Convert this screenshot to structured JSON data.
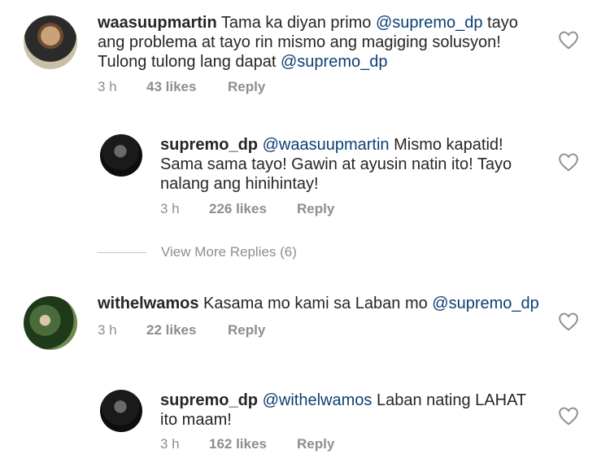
{
  "comments": [
    {
      "username": "waasuupmartin",
      "text_parts": [
        "Tama ka diyan primo ",
        "@supremo_dp",
        " tayo ang problema at tayo rin mismo ang magiging solusyon! Tulong tulong lang dapat ",
        "@supremo_dp"
      ],
      "time": "3 h",
      "likes": "43 likes",
      "reply": "Reply",
      "avatar_icon": "user-avatar-icon"
    },
    {
      "username": "supremo_dp",
      "text_parts": [
        "@waasuupmartin",
        " Mismo kapatid! Sama sama tayo! Gawin at ayusin natin ito! Tayo nalang ang hinihintay!"
      ],
      "time": "3 h",
      "likes": "226 likes",
      "reply": "Reply",
      "avatar_icon": "user-avatar-icon"
    },
    {
      "username": "withelwamos",
      "text_parts": [
        "Kasama mo kami sa Laban mo ",
        "@supremo_dp"
      ],
      "time": "3 h",
      "likes": "22 likes",
      "reply": "Reply",
      "avatar_icon": "user-avatar-icon"
    },
    {
      "username": "supremo_dp",
      "text_parts": [
        "@withelwamos",
        " Laban nating LAHAT ito maam!"
      ],
      "time": "3 h",
      "likes": "162 likes",
      "reply": "Reply",
      "avatar_icon": "user-avatar-icon"
    }
  ],
  "view_more_replies": "View More Replies (6)",
  "colors": {
    "mention": "#0d3f73",
    "meta": "#8e8e8e",
    "text": "#262626"
  }
}
